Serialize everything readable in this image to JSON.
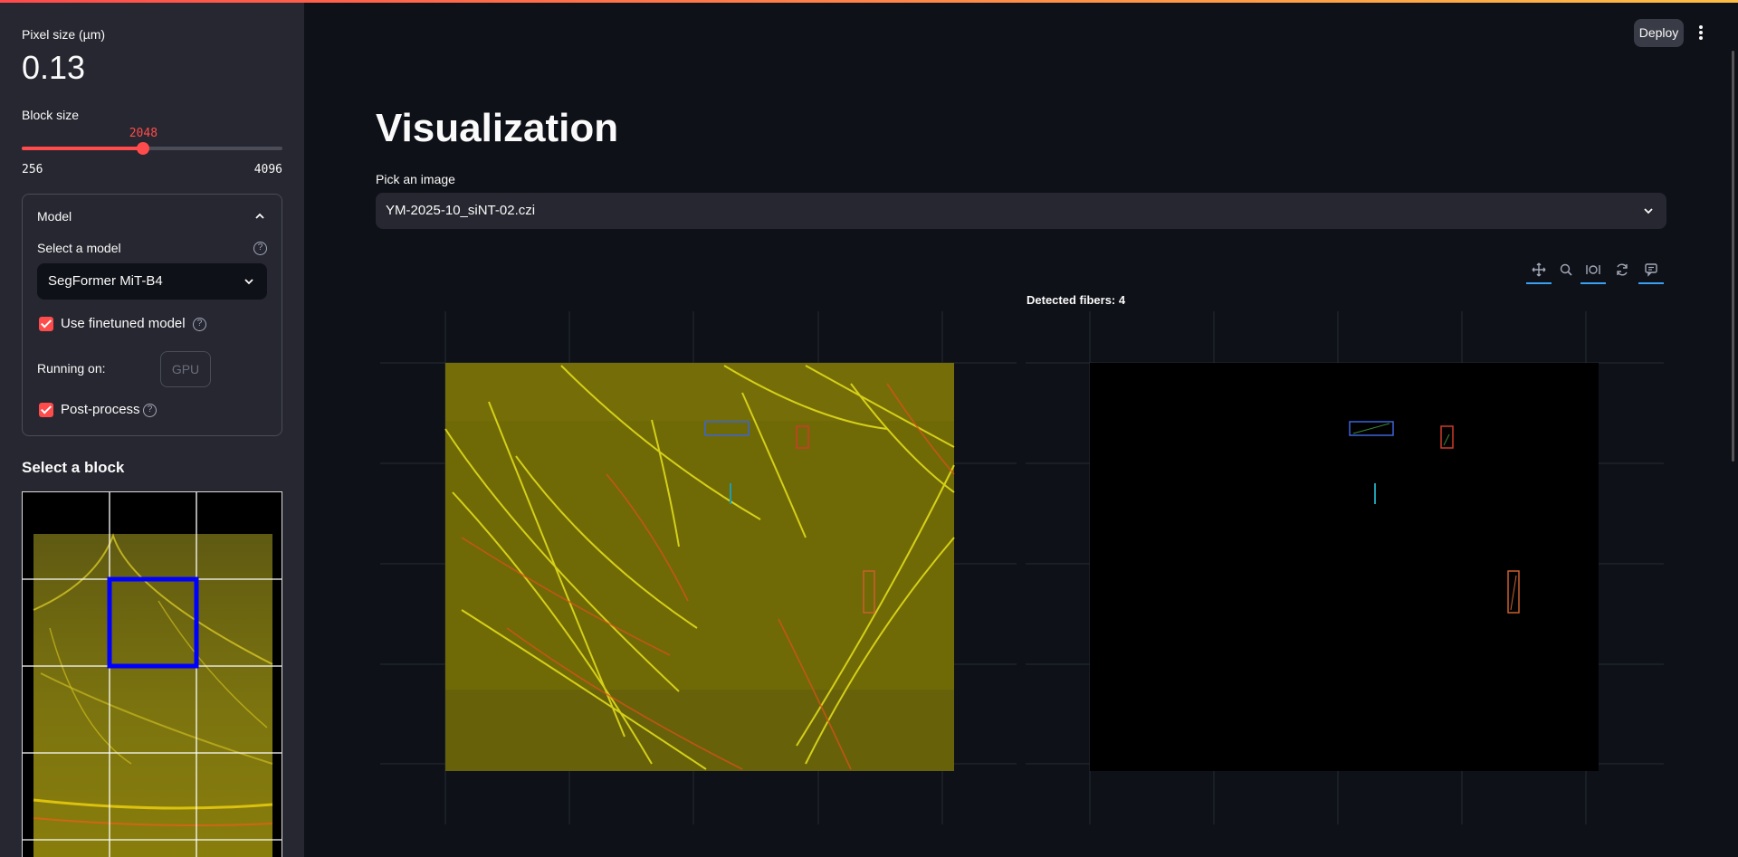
{
  "sidebar": {
    "pixel_size_label": "Pixel size (µm)",
    "pixel_size_value": "0.13",
    "block_size_label": "Block size",
    "block_size": {
      "value": 2048,
      "min": 256,
      "max": 4096,
      "value_text": "2048",
      "min_text": "256",
      "max_text": "4096"
    },
    "model_expander": {
      "header": "Model",
      "select_label": "Select a model",
      "selected_model": "SegFormer MiT-B4",
      "finetuned_label": "Use finetuned model",
      "finetuned_checked": true,
      "running_on_label": "Running on:",
      "device_button": "GPU",
      "postprocess_label": "Post-process",
      "postprocess_checked": true
    },
    "select_block_title": "Select a block",
    "block_grid": {
      "columns": 3,
      "rows": 5,
      "selected": {
        "column": 1,
        "row": 1
      }
    }
  },
  "header": {
    "deploy_label": "Deploy"
  },
  "main": {
    "title": "Visualization",
    "pick_label": "Pick an image",
    "selected_image": "YM-2025-10_siNT-02.czi",
    "toolbar": [
      "pan-tool",
      "zoom-tool",
      "autoscale-tool",
      "reset-tool",
      "hover-tool"
    ],
    "figure_title": "Detected fibers: 4"
  },
  "colors": {
    "accent": "#ff4b4b",
    "selection_box": "#0000ff",
    "background": "#0e1117",
    "sidebar": "#262730"
  }
}
